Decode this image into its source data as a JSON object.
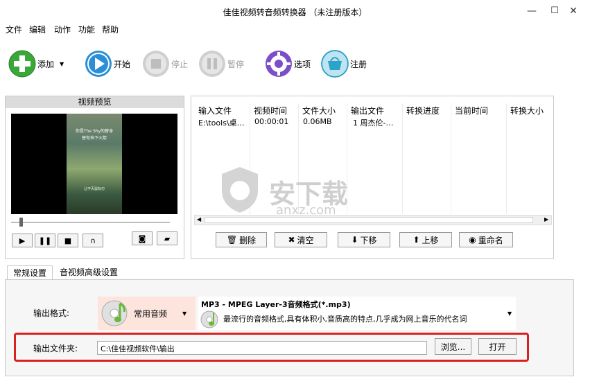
{
  "window": {
    "title": "佳佳视频转音频转换器 （未注册版本）",
    "minimize": "—",
    "maximize": "☐",
    "close": "✕"
  },
  "menu": [
    "文件",
    "编辑",
    "动作",
    "功能",
    "帮助"
  ],
  "toolbar": {
    "add": "添加",
    "start": "开始",
    "stop": "停止",
    "pause": "暂停",
    "options": "选项",
    "register": "注册"
  },
  "preview": {
    "title": "视频预览",
    "caption1": "你是The Shy的替身",
    "caption2": "替你挡下火箭",
    "caption3": "让不灭鼠标刃"
  },
  "list": {
    "columns": [
      "输入文件",
      "视频时间",
      "文件大小",
      "输出文件",
      "转换进度",
      "当前时间",
      "转换大小"
    ],
    "rows": [
      [
        "E:\\tools\\桌…",
        "00:00:01",
        "0.06MB",
        "1 周杰伦-…",
        "",
        "",
        ""
      ]
    ]
  },
  "list_buttons": {
    "delete": "删除",
    "clear": "清空",
    "down": "下移",
    "up": "上移",
    "rename": "重命名"
  },
  "tabs": [
    "常规设置",
    "音视频高级设置"
  ],
  "settings": {
    "format_label": "输出格式:",
    "format_category": "常用音频",
    "format_name": "MP3 - MPEG Layer-3音频格式(*.mp3)",
    "format_desc": "最流行的音频格式,具有体积小,音质高的特点,几乎成为网上音乐的代名词",
    "folder_label": "输出文件夹:",
    "folder_value": "C:\\佳佳视频软件\\输出",
    "browse": "浏览...",
    "open": "打开"
  },
  "watermark": {
    "text": "安下载",
    "sub": "anxz.com"
  },
  "colors": {
    "add": "#3aa838",
    "start": "#2a8fd8",
    "options": "#7b4fc8",
    "register": "#2aa4c8",
    "highlight": "#d9211e"
  }
}
